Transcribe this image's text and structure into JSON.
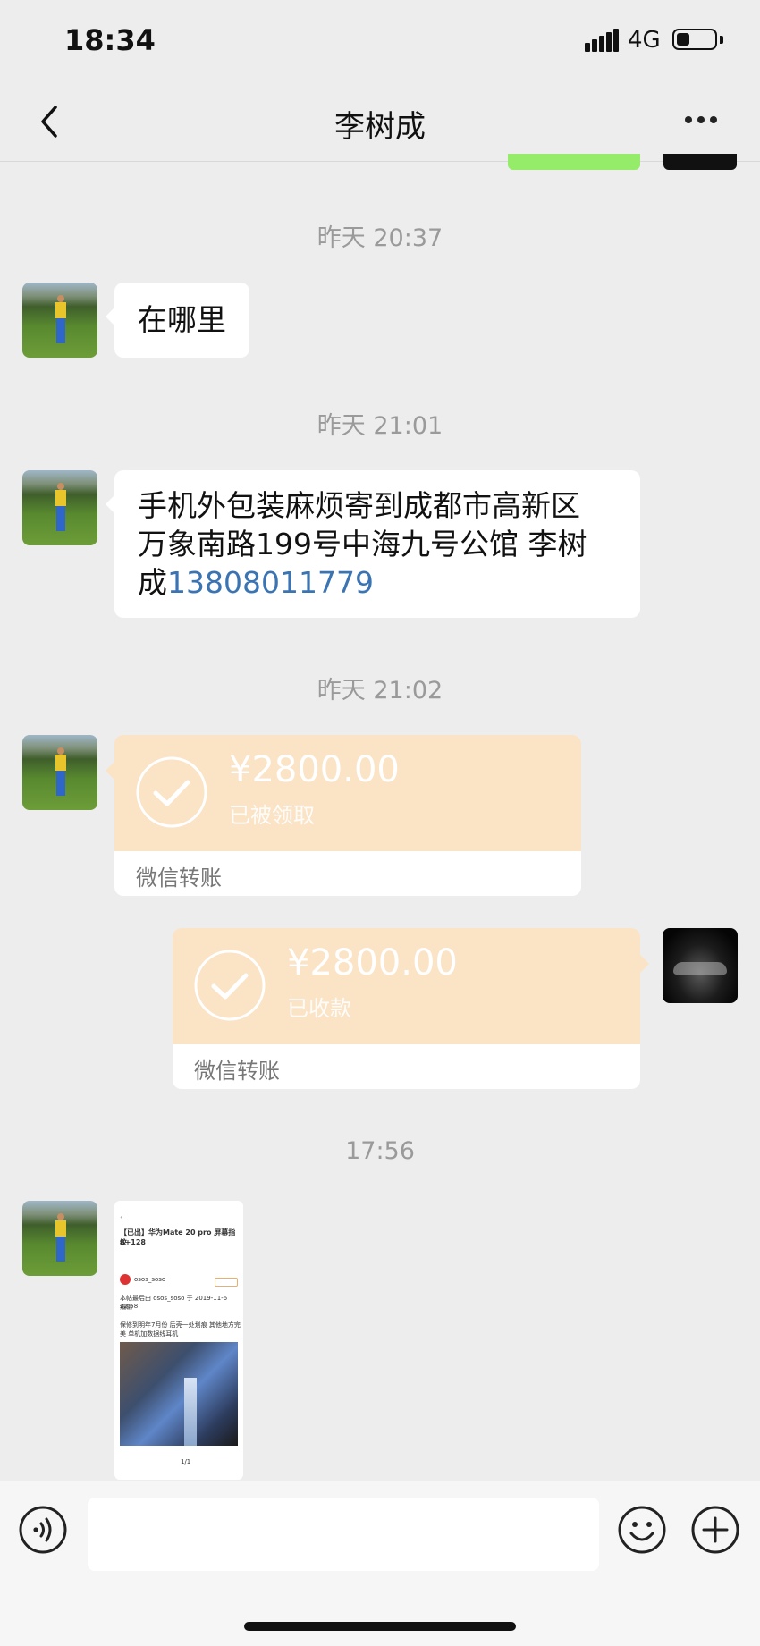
{
  "status": {
    "time": "18:34",
    "network": "4G",
    "battery_level": 0.35
  },
  "header": {
    "title": "李树成",
    "back_icon": "chevron-left-icon",
    "more_icon": "more-dots-icon"
  },
  "messages": [
    {
      "timestamp": "昨天 20:37",
      "sender": "contact",
      "text": "在哪里"
    },
    {
      "timestamp": "昨天 21:01",
      "sender": "contact",
      "text_lines": [
        "手机外包装麻烦寄到成都市高新区",
        "万象南路199号中海九号公馆 李树"
      ],
      "text_tail": "成",
      "phone": "13808011779"
    },
    {
      "timestamp": "昨天 21:02",
      "sender": "contact",
      "type": "transfer",
      "amount": "¥2800.00",
      "status": "已被领取",
      "label": "微信转账"
    },
    {
      "sender": "me",
      "type": "transfer",
      "amount": "¥2800.00",
      "status": "已收款",
      "label": "微信转账"
    },
    {
      "timestamp": "17:56",
      "sender": "contact",
      "type": "image",
      "image_text": {
        "title_line1": "【已出】华为Mate 20 pro 屏幕指纹",
        "title_line2": "8+128",
        "user": "osos_soso",
        "edit_note": "本帖最后由 osos_soso 于 2019-11-6 22:58",
        "edit_note2": "编辑",
        "body1": "保修到明年7月份 后壳一处划痕 其他地方完",
        "body2": "美 单机加数据线耳机",
        "page": "1/1"
      }
    }
  ],
  "input_bar": {
    "voice_icon": "voice-icon",
    "emoji_icon": "emoji-icon",
    "plus_icon": "plus-icon"
  },
  "colors": {
    "background": "#ededed",
    "transfer": "#fbe3c6",
    "link": "#3a74b3",
    "my_bubble": "#95ec69"
  }
}
